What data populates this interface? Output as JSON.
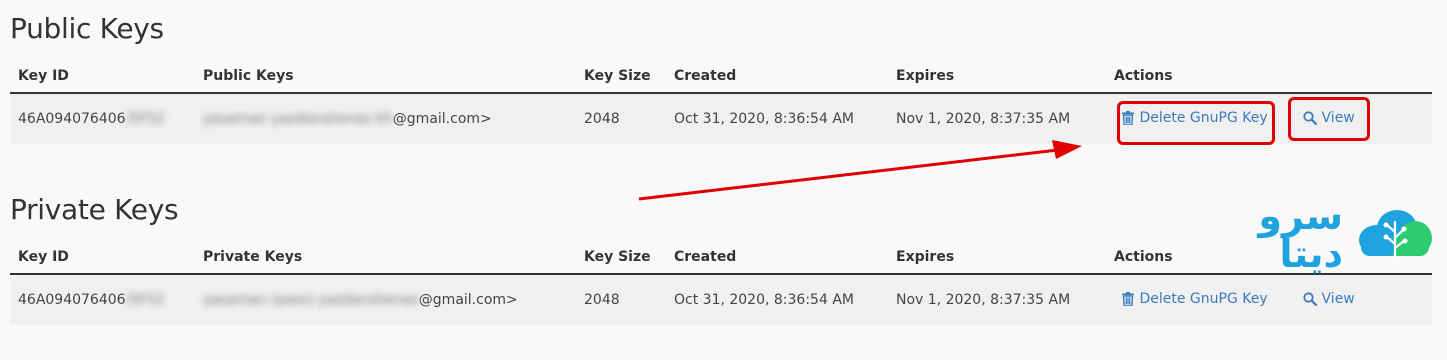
{
  "public_section": {
    "title": "Public Keys",
    "columns": [
      "Key ID",
      "Public Keys",
      "Key Size",
      "Created",
      "Expires",
      "Actions"
    ],
    "rows": [
      {
        "key_id_visible": "46A094076406",
        "key_id_hidden": "/5F52",
        "name_hidden": "yasaman yazdanshenas kh",
        "email_visible": "@gmail.com>",
        "key_size": "2048",
        "created": "Oct 31, 2020, 8:36:54 AM",
        "expires": "Nov 1, 2020, 8:37:35 AM",
        "delete_label": "Delete GnuPG Key",
        "view_label": "View"
      }
    ]
  },
  "private_section": {
    "title": "Private Keys",
    "columns": [
      "Key ID",
      "Private Keys",
      "Key Size",
      "Created",
      "Expires",
      "Actions"
    ],
    "rows": [
      {
        "key_id_visible": "46A094076406",
        "key_id_hidden": "/5F52",
        "name_hidden": "yasaman (pass) yazdanshenas",
        "email_visible": "@gmail.com>",
        "key_size": "2048",
        "created": "Oct 31, 2020, 8:36:54 AM",
        "expires": "Nov 1, 2020, 8:37:35 AM",
        "delete_label": "Delete GnuPG Key",
        "view_label": "View"
      }
    ]
  },
  "logo": {
    "text": "سرو دیتا"
  },
  "colors": {
    "link": "#3a7bc0",
    "highlight": "#e00000",
    "logo_blue": "#1ea3df",
    "logo_green": "#2ecc71"
  },
  "icons": {
    "delete": "trash-icon",
    "view": "search-icon"
  }
}
